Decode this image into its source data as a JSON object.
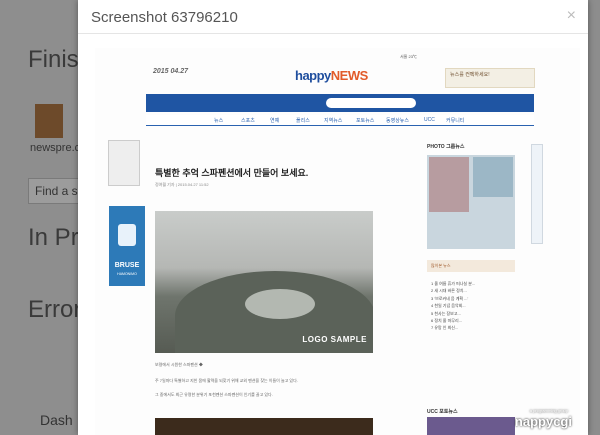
{
  "background": {
    "heading_finish": "Finis",
    "newspre_label": "newspre.c",
    "find_placeholder": "Find a s",
    "heading_inpr": "In Pr",
    "heading_error": "Error",
    "dash_label": "Dash"
  },
  "modal": {
    "title": "Screenshot 63796210",
    "close": "×"
  },
  "site": {
    "logo_prefix": "happy",
    "logo_suffix": "NEWS",
    "date": "2015 04.27",
    "weather": "서울 23℃",
    "ad_text": "뉴스를 컨펙하세요!",
    "menu": [
      "뉴스",
      "스포츠",
      "연예",
      "폴리스",
      "지역뉴스",
      "포토뉴스",
      "동영상뉴스",
      "UCC",
      "커뮤니티"
    ],
    "article_title": "특별한 추억 스파펜션에서 만들어 보세요.",
    "article_meta": "정여월 기자 | 2015.04.27 11:52",
    "photo_label": "LOGO SAMPLE",
    "caption_1": "보령에서 시원한 스파펜션 ◆",
    "caption_2": "주 7일마다 특별하고 지친 몸에 활력을 되찾기 위해 교외 펜션을 찾는 이들이 늘고 있다.",
    "caption_3": "그 중에서도 최근 유명한 분위기 포천펜션 스파펜션이 인기를 끌고 있다.",
    "right_head": "PHOTO 그룹뉴스",
    "right_tabs": "많이본 뉴스",
    "right_list": [
      "1  올 여름 휴가 떠나실 분...",
      "2  새 시대 바른 정치...",
      "3  '브로커네 음 계획 ...'",
      "4  천일 기념 음악회...",
      "5  천사는 장보고...",
      "6  정치 올 마무리...",
      "7  유망 인 최신..."
    ],
    "ucc_label": "UCC 포토뉴스",
    "ad_brand": "BRUSE",
    "ad_sub": "HAMONIMO"
  },
  "watermark": {
    "brand": "nappycgi",
    "tagline": "a programming group"
  }
}
